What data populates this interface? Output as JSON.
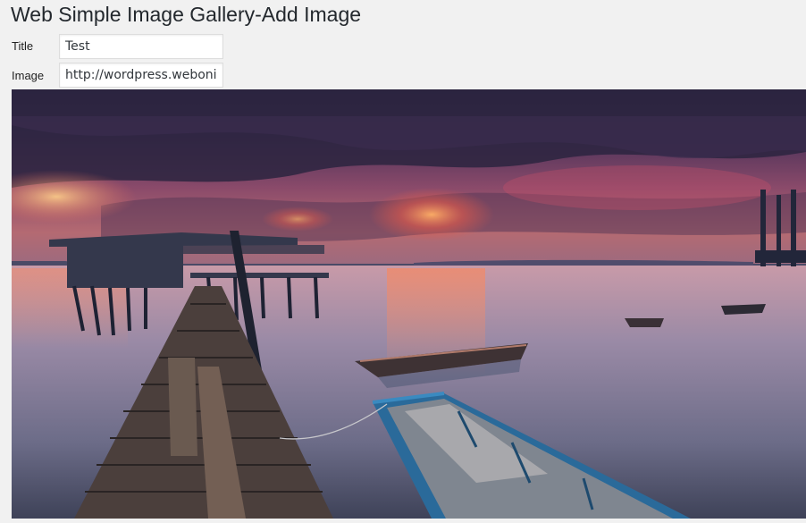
{
  "page": {
    "title": "Web Simple Image Gallery-Add Image"
  },
  "form": {
    "title_label": "Title",
    "title_value": "Test",
    "image_label": "Image",
    "image_value": "http://wordpress.webonise.com/wp-content/uploads/"
  },
  "preview": {
    "image_name": "sunset-pier-boats-photo"
  },
  "colors": {
    "background": "#f1f1f1",
    "input_border": "#dddddd",
    "title_text": "#23282d"
  }
}
